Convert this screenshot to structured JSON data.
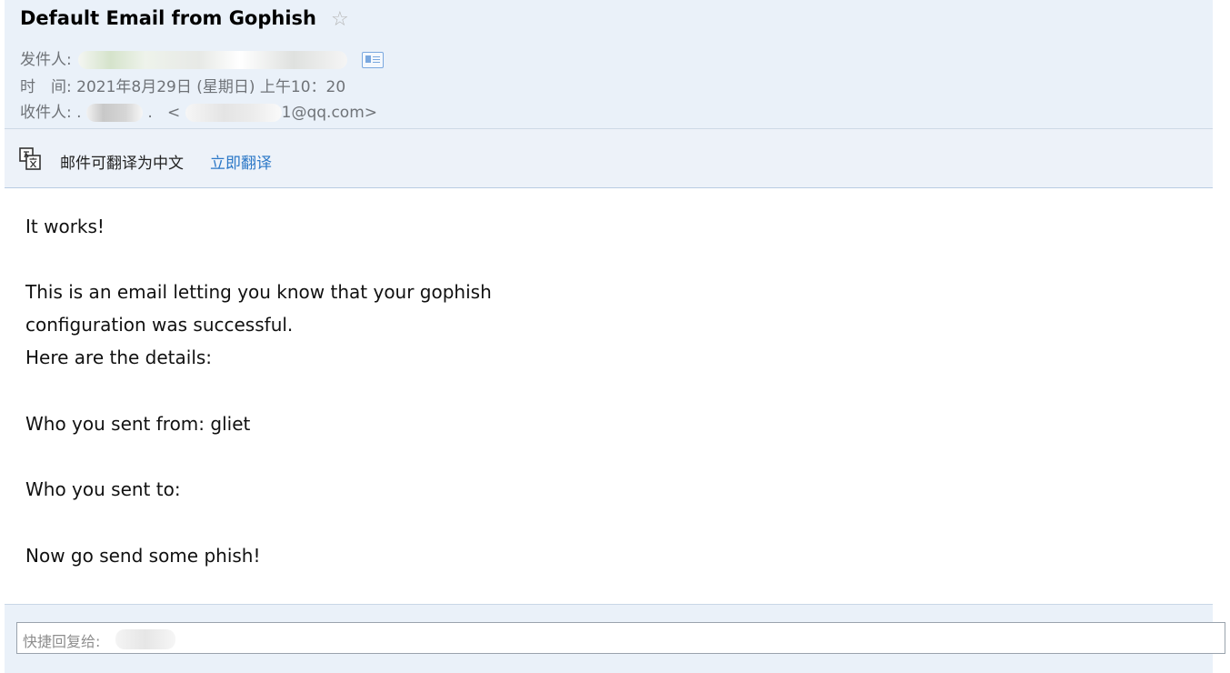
{
  "email": {
    "subject": "Default Email from Gophish",
    "star_icon": "star-icon",
    "from_label": "发件人:",
    "time_label": "时　间:",
    "time_value": "2021年8月29日 (星期日) 上午10：20",
    "to_label": "收件人:",
    "to_email_open": "<",
    "to_email_tail": "1@qq.com>",
    "to_name_tail": ".",
    "to_name_prefix": "."
  },
  "translate": {
    "icon": "translate-icon",
    "text": "邮件可翻译为中文",
    "link": "立即翻译"
  },
  "body": {
    "lines": [
      "It works!",
      "This is an email letting you know that your gophish",
      "configuration was successful.",
      "Here are the details:",
      "Who you sent from: gliet",
      "Who you sent to:",
      "Now go send some phish!"
    ]
  },
  "reply": {
    "placeholder": "快捷回复给:"
  },
  "colors": {
    "header_bg": "#eaf1f9",
    "link": "#2c78c7",
    "meta_text": "#6f7378"
  }
}
